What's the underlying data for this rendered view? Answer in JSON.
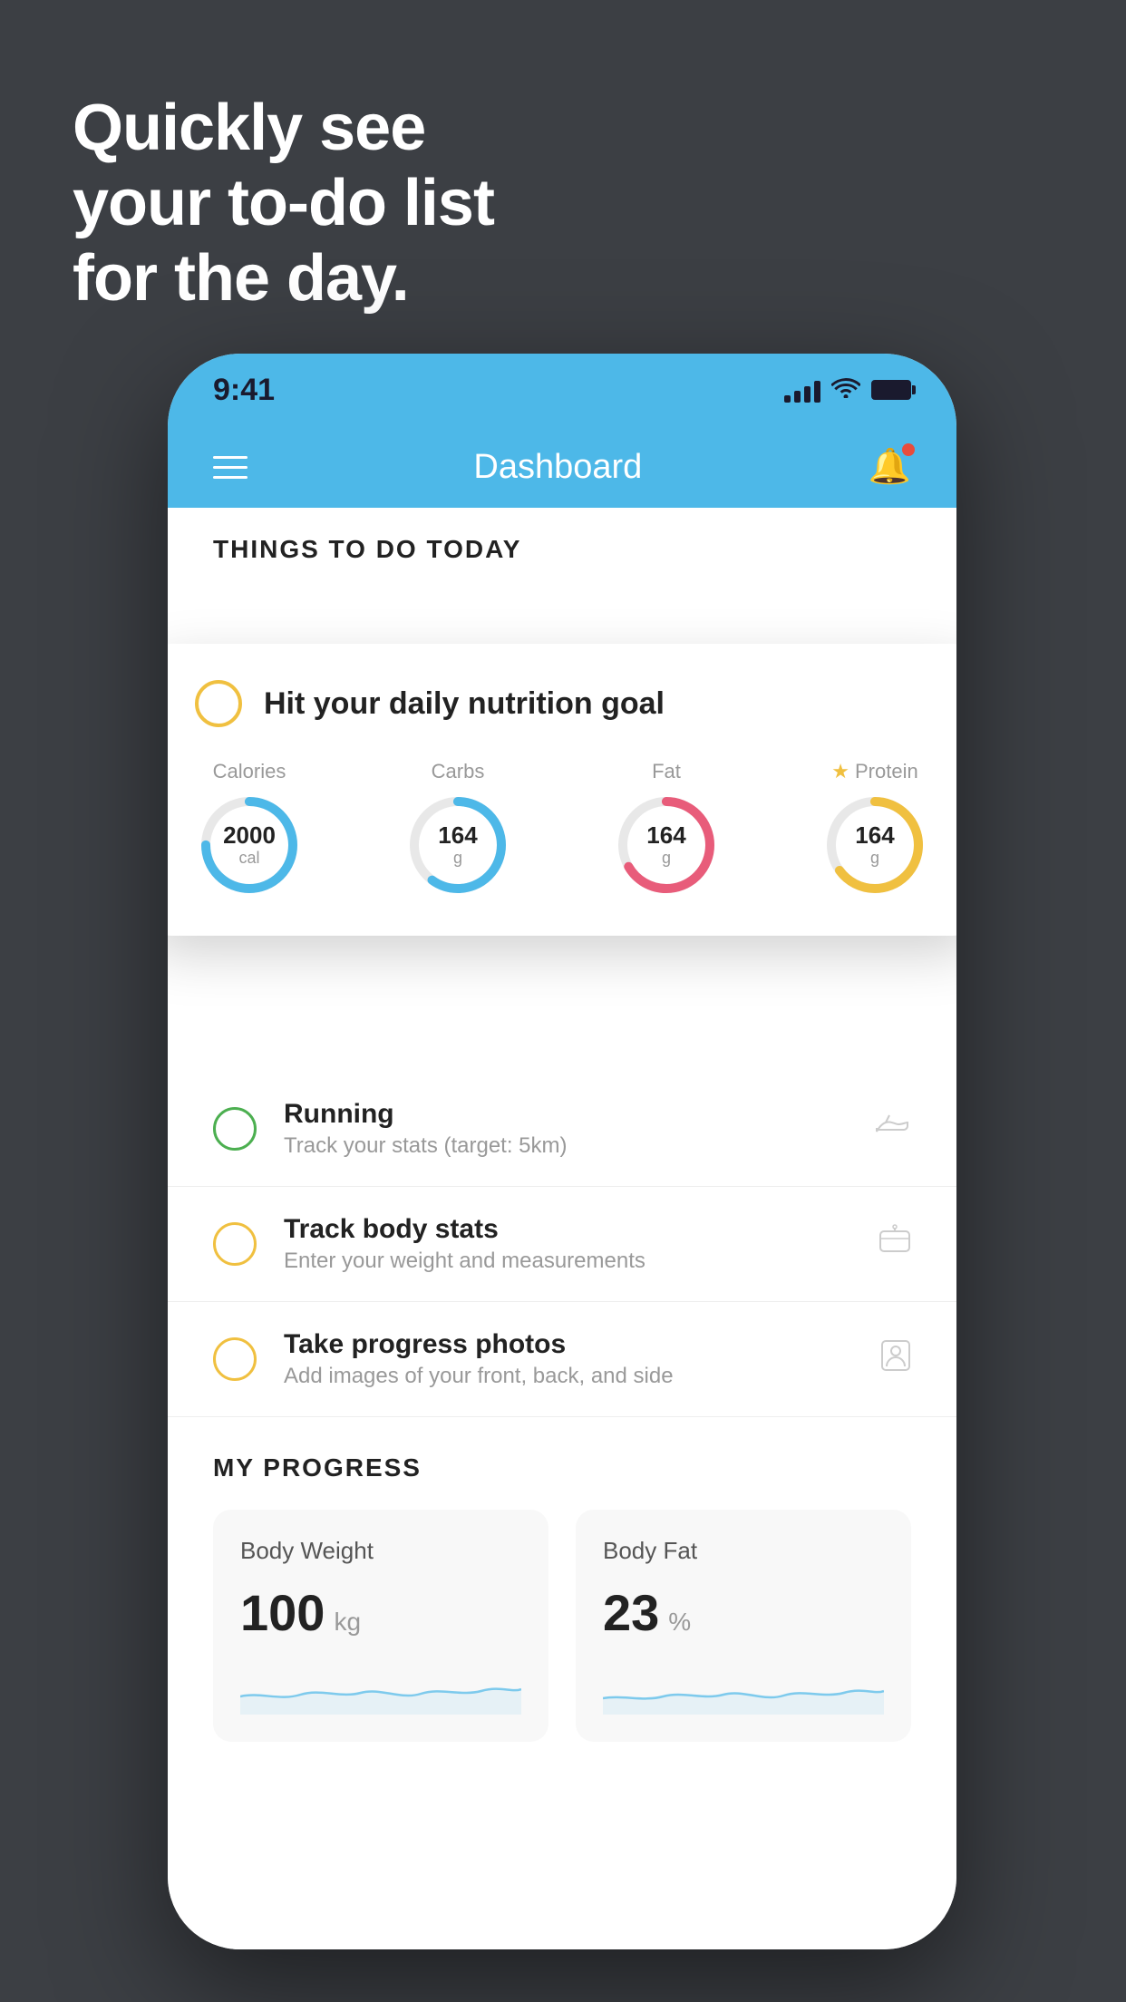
{
  "headline": {
    "line1": "Quickly see",
    "line2": "your to-do list",
    "line3": "for the day."
  },
  "status_bar": {
    "time": "9:41"
  },
  "nav": {
    "title": "Dashboard"
  },
  "things_header": "THINGS TO DO TODAY",
  "nutrition_card": {
    "title": "Hit your daily nutrition goal",
    "stats": [
      {
        "label": "Calories",
        "value": "2000",
        "unit": "cal",
        "color": "#4db8e8",
        "track": 75,
        "starred": false
      },
      {
        "label": "Carbs",
        "value": "164",
        "unit": "g",
        "color": "#4db8e8",
        "track": 60,
        "starred": false
      },
      {
        "label": "Fat",
        "value": "164",
        "unit": "g",
        "color": "#e85c7a",
        "track": 80,
        "starred": false
      },
      {
        "label": "Protein",
        "value": "164",
        "unit": "g",
        "color": "#f0c040",
        "track": 65,
        "starred": true
      }
    ]
  },
  "todo_items": [
    {
      "title": "Running",
      "subtitle": "Track your stats (target: 5km)",
      "circle_color": "green",
      "icon": "shoe"
    },
    {
      "title": "Track body stats",
      "subtitle": "Enter your weight and measurements",
      "circle_color": "yellow",
      "icon": "scale"
    },
    {
      "title": "Take progress photos",
      "subtitle": "Add images of your front, back, and side",
      "circle_color": "yellow",
      "icon": "person"
    }
  ],
  "progress_section": {
    "header": "MY PROGRESS",
    "cards": [
      {
        "title": "Body Weight",
        "value": "100",
        "unit": "kg"
      },
      {
        "title": "Body Fat",
        "value": "23",
        "unit": "%"
      }
    ]
  }
}
